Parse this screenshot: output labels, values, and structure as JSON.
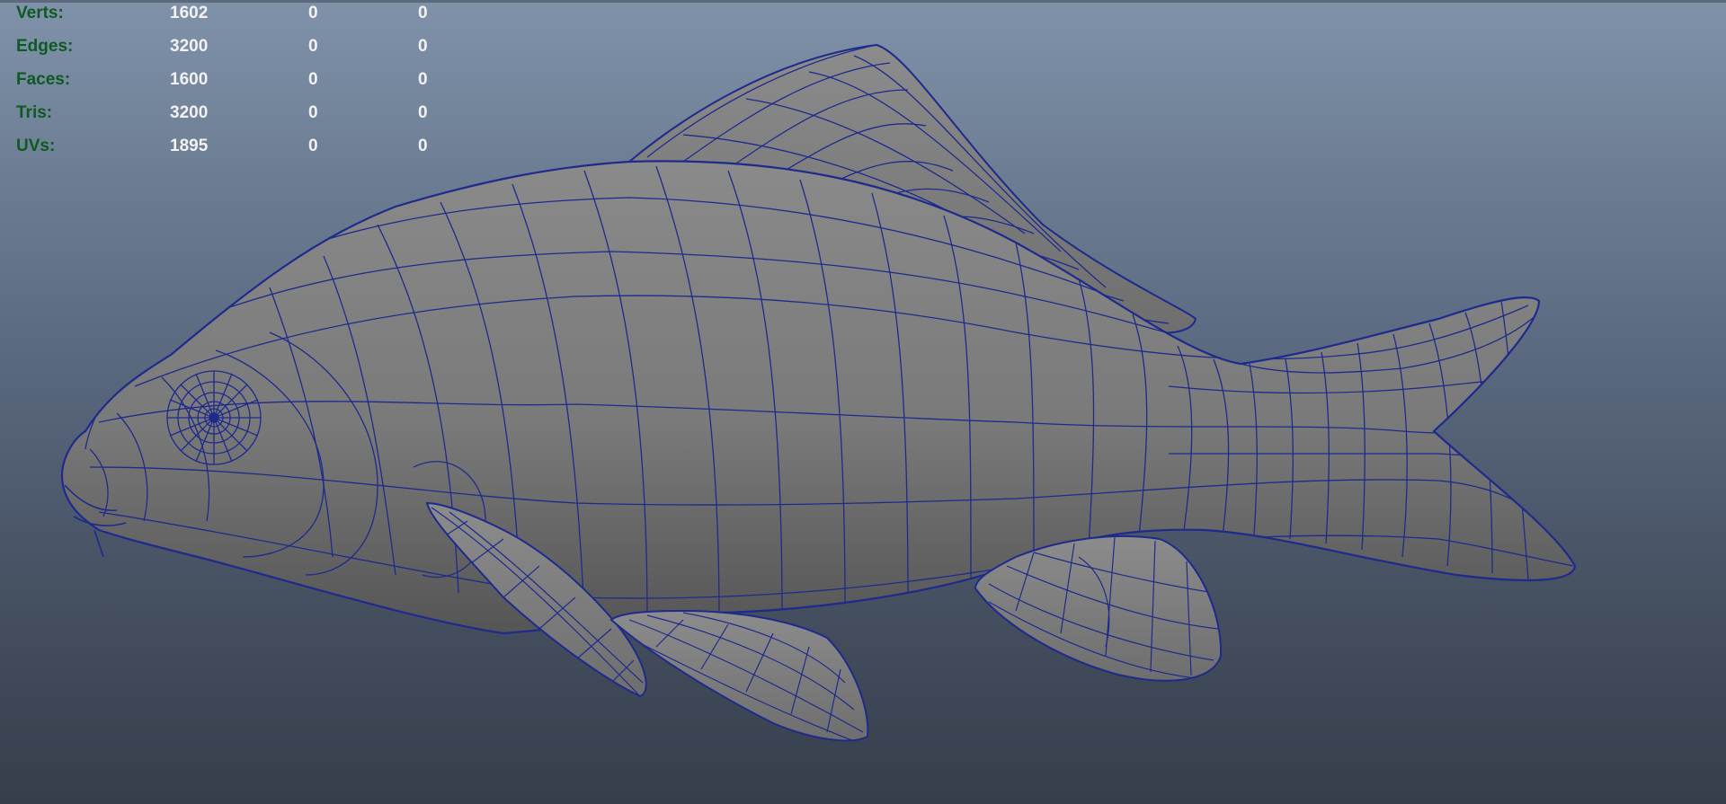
{
  "viewport": {
    "colors": {
      "bg_top": "#8092aa",
      "bg_bottom": "#363e4b",
      "wire": "#1e2a8c",
      "surface": "#7c7c7c",
      "hud_label": "#0d5a22",
      "hud_value": "#f2f2f2"
    },
    "object": "fish mesh (wireframe on shaded)",
    "hud": {
      "rows": [
        {
          "label": "Verts:",
          "v1": "1602",
          "v2": "0",
          "v3": "0"
        },
        {
          "label": "Edges:",
          "v1": "3200",
          "v2": "0",
          "v3": "0"
        },
        {
          "label": "Faces:",
          "v1": "1600",
          "v2": "0",
          "v3": "0"
        },
        {
          "label": "Tris:",
          "v1": "3200",
          "v2": "0",
          "v3": "0"
        },
        {
          "label": "UVs:",
          "v1": "1895",
          "v2": "0",
          "v3": "0"
        }
      ]
    }
  }
}
